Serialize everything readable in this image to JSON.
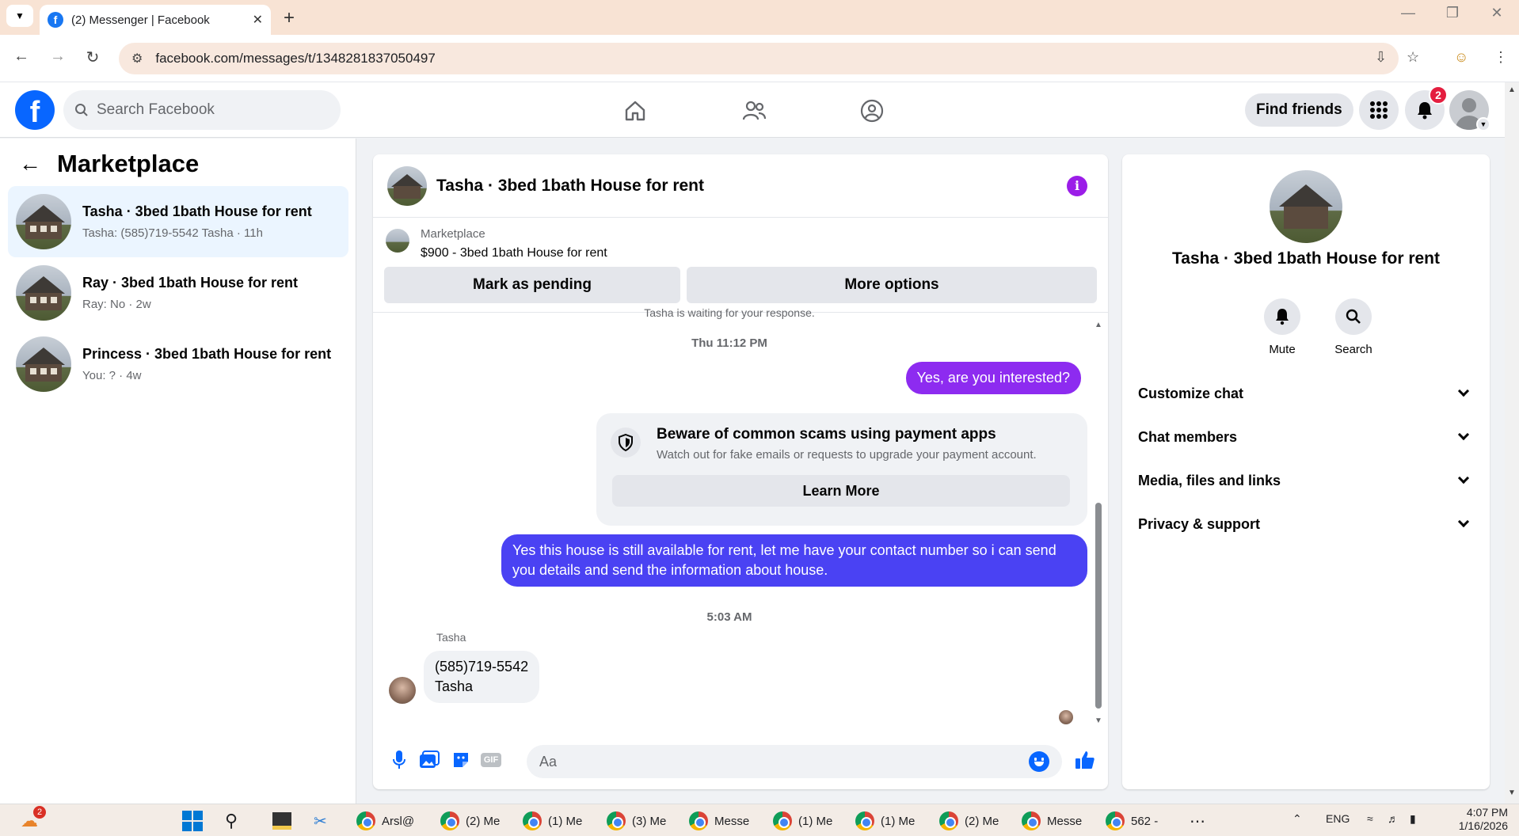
{
  "browser": {
    "tab_title": "(2) Messenger | Facebook",
    "url": "facebook.com/messages/t/1348281837050497"
  },
  "fb": {
    "search_placeholder": "Search Facebook",
    "find_friends": "Find friends",
    "notification_count": "2"
  },
  "sidebar": {
    "title": "Marketplace",
    "conversations": [
      {
        "name": "Tasha · 3bed 1bath House for rent",
        "preview": "Tasha: (585)719-5542 Tasha · 11h",
        "active": true
      },
      {
        "name": "Ray · 3bed 1bath House for rent",
        "preview": "Ray: No · 2w",
        "active": false
      },
      {
        "name": "Princess · 3bed 1bath House for rent",
        "preview": "You: ? · 4w",
        "active": false
      }
    ]
  },
  "chat": {
    "title": "Tasha · 3bed 1bath House for rent",
    "listing_label": "Marketplace",
    "listing_price": "$900 - 3bed 1bath House for rent",
    "mark_pending": "Mark as pending",
    "more_options": "More options",
    "cutoff_text": "Tasha is waiting for your response.",
    "timestamp1": "Thu 11:12 PM",
    "msg_out1": "Yes, are you interested?",
    "warning_title": "Beware of common scams using payment apps",
    "warning_sub": "Watch out for fake emails or requests to upgrade your payment account.",
    "learn_more": "Learn More",
    "msg_out2": "Yes this house is still available for rent, let me have your contact number so i can send you details and send the information about house.",
    "timestamp2": "5:03 AM",
    "sender": "Tasha",
    "msg_in_line1": "(585)719-5542",
    "msg_in_line2": "Tasha",
    "composer_placeholder": "Aa"
  },
  "details": {
    "name": "Tasha · 3bed 1bath House for rent",
    "mute": "Mute",
    "search": "Search",
    "sections": [
      "Customize chat",
      "Chat members",
      "Media, files and links",
      "Privacy & support"
    ]
  },
  "taskbar": {
    "apps": [
      {
        "label": "Arsl@"
      },
      {
        "label": "(2) Me"
      },
      {
        "label": "(1) Me"
      },
      {
        "label": "(3) Me"
      },
      {
        "label": "Messe"
      },
      {
        "label": "(1) Me"
      },
      {
        "label": "(1) Me"
      },
      {
        "label": "(2) Me"
      },
      {
        "label": "Messe"
      },
      {
        "label": "562 -"
      }
    ],
    "weather_badge": "2",
    "lang": "ENG",
    "time": "4:07 PM",
    "date": "1/16/2026"
  },
  "colors": {
    "fb_blue": "#0866ff",
    "messenger_purple": "#8d2bf0",
    "messenger_indigo": "#4a42f3",
    "active_row": "#ebf5ff"
  }
}
